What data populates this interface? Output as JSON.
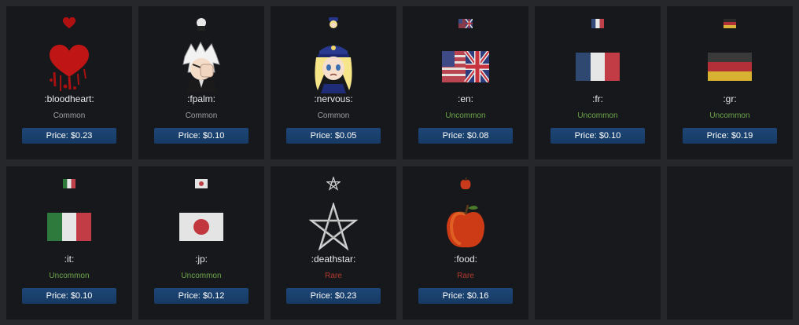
{
  "items": [
    {
      "name": ":bloodheart:",
      "rarity": "Common",
      "price": "Price: $0.23",
      "icon": "bloodheart-icon"
    },
    {
      "name": ":fpalm:",
      "rarity": "Common",
      "price": "Price: $0.10",
      "icon": "fpalm-icon"
    },
    {
      "name": ":nervous:",
      "rarity": "Common",
      "price": "Price: $0.05",
      "icon": "nervous-icon"
    },
    {
      "name": ":en:",
      "rarity": "Uncommon",
      "price": "Price: $0.08",
      "icon": "uk-flag-icon"
    },
    {
      "name": ":fr:",
      "rarity": "Uncommon",
      "price": "Price: $0.10",
      "icon": "france-flag-icon"
    },
    {
      "name": ":gr:",
      "rarity": "Uncommon",
      "price": "Price: $0.19",
      "icon": "germany-flag-icon"
    },
    {
      "name": ":it:",
      "rarity": "Uncommon",
      "price": "Price: $0.10",
      "icon": "italy-flag-icon"
    },
    {
      "name": ":jp:",
      "rarity": "Uncommon",
      "price": "Price: $0.12",
      "icon": "japan-flag-icon"
    },
    {
      "name": ":deathstar:",
      "rarity": "Rare",
      "price": "Price: $0.23",
      "icon": "pentagram-icon"
    },
    {
      "name": ":food:",
      "rarity": "Rare",
      "price": "Price: $0.16",
      "icon": "apple-icon"
    }
  ],
  "rarity_colors": {
    "Common": "#a0a0a0",
    "Uncommon": "#6ea84a",
    "Rare": "#b53a2e"
  }
}
